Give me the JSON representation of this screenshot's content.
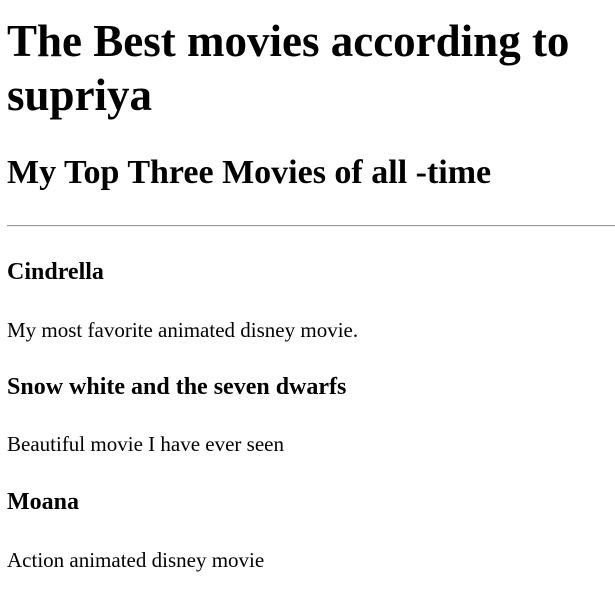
{
  "page": {
    "title": "The Best movies according to supriya",
    "subtitle": "My Top Three Movies of all -time"
  },
  "movies": [
    {
      "title": "Cindrella",
      "description": "My most favorite animated disney movie."
    },
    {
      "title": "Snow white and the seven dwarfs",
      "description": "Beautiful movie I have ever seen"
    },
    {
      "title": "Moana",
      "description": "Action animated disney movie"
    }
  ]
}
